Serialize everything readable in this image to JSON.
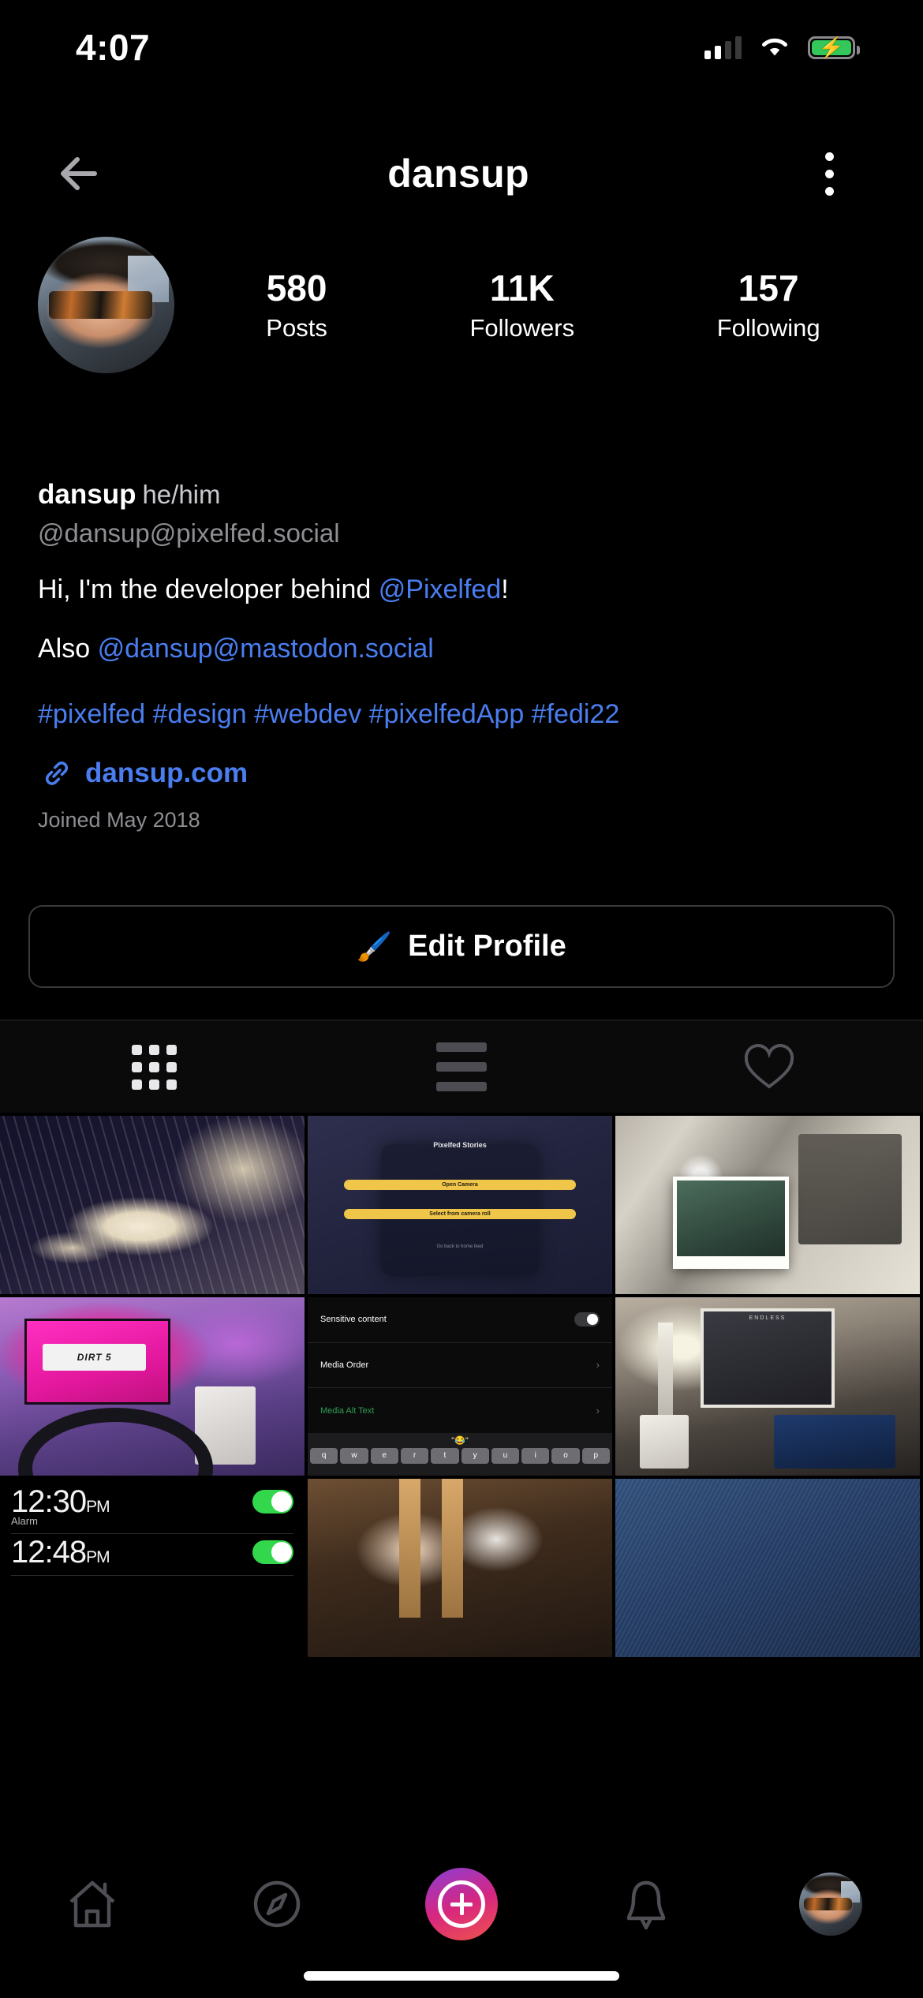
{
  "status_bar": {
    "time": "4:07",
    "signal_icon": "cellular-signal-icon",
    "signal_bars_filled": 2,
    "signal_bars_total": 4,
    "wifi_icon": "wifi-icon",
    "battery_icon": "battery-charging-icon",
    "battery_color": "#34c759"
  },
  "header": {
    "back_icon": "back-arrow-icon",
    "title": "dansup",
    "menu_icon": "kebab-menu-icon"
  },
  "profile": {
    "avatar_name": "profile-avatar",
    "stats": [
      {
        "value": "580",
        "label": "Posts"
      },
      {
        "value": "11K",
        "label": "Followers"
      },
      {
        "value": "157",
        "label": "Following"
      }
    ],
    "display_name": "dansup",
    "pronouns": "he/him",
    "handle": "@dansup@pixelfed.social",
    "bio_line1_pre": "Hi, I'm the developer behind ",
    "bio_line1_link": "@Pixelfed",
    "bio_line1_post": "!",
    "bio_line2_pre": "Also ",
    "bio_line2_link": "@dansup@mastodon.social",
    "hashtags": "#pixelfed #design #webdev #pixelfedApp #fedi22",
    "link_icon": "link-icon",
    "website": "dansup.com",
    "joined": "Joined May 2018",
    "edit_button_icon": "paintbrush-icon",
    "edit_button_label": "Edit Profile"
  },
  "tabs": [
    {
      "name": "grid",
      "icon": "grid-view-icon",
      "active": true
    },
    {
      "name": "feed",
      "icon": "list-view-icon",
      "active": false
    },
    {
      "name": "likes",
      "icon": "heart-icon",
      "active": false
    }
  ],
  "grid": {
    "cells": [
      {
        "name": "post-cat-photo",
        "alt": "black and white cat lying on blanket, sepia filter"
      },
      {
        "name": "post-pixelfed-stories",
        "alt": "phone screenshot showing Pixelfed Stories sheet",
        "overlay": {
          "title": "Pixelfed Stories",
          "option1": "Open Camera",
          "option2": "Select from camera roll",
          "hint": "Go back to home feed"
        }
      },
      {
        "name": "post-polaroid-photo",
        "alt": "polaroid photo leaning against white surface"
      },
      {
        "name": "post-racing-setup",
        "alt": "racing wheel and monitor showing DIRT 5 in pink lighting",
        "overlay": {
          "logo": "DIRT 5"
        }
      },
      {
        "name": "post-media-settings",
        "alt": "app settings screen with keyboard",
        "overlay": {
          "rows": [
            {
              "label": "Sensitive content",
              "control": "toggle",
              "on": false
            },
            {
              "label": "Media Order",
              "control": "chevron"
            },
            {
              "label": "Media Alt Text",
              "control": "chevron",
              "accent": "#2f9e54"
            }
          ],
          "emoji": "\"😂\"",
          "keys": [
            "q",
            "w",
            "e",
            "r",
            "t",
            "y",
            "u",
            "i",
            "o",
            "p"
          ]
        }
      },
      {
        "name": "post-desk-setup",
        "alt": "desk setup with lamp, poster, speakers and laptop",
        "overlay": {
          "poster_caption": "ENDLESS"
        }
      },
      {
        "name": "post-alarm-screenshot",
        "alt": "iOS alarm list screenshot",
        "overlay": {
          "alarms": [
            {
              "time": "12:30",
              "meridiem": "PM",
              "label": "Alarm",
              "on": true
            },
            {
              "time": "12:48",
              "meridiem": "PM",
              "label": "",
              "on": true
            }
          ]
        }
      },
      {
        "name": "post-wedding-photo",
        "alt": "wedding couple indoors warm tones"
      },
      {
        "name": "post-denim-photo",
        "alt": "close up of blue denim fabric"
      }
    ]
  },
  "bottom_nav": [
    {
      "name": "home",
      "icon": "home-icon"
    },
    {
      "name": "discover",
      "icon": "compass-icon"
    },
    {
      "name": "create",
      "icon": "plus-circle-icon"
    },
    {
      "name": "notifications",
      "icon": "bell-icon"
    },
    {
      "name": "profile",
      "icon": "avatar-icon"
    }
  ]
}
